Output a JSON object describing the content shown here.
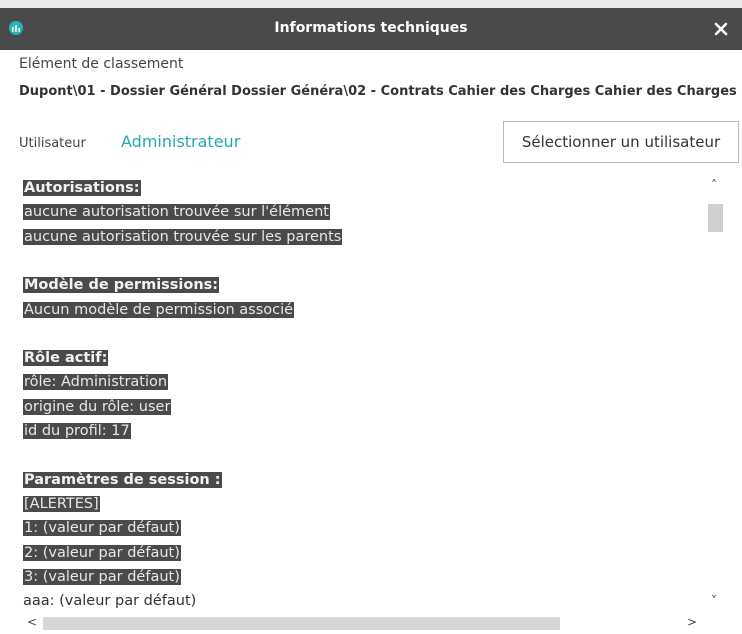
{
  "window": {
    "title": "Informations techniques",
    "close_glyph": "✕"
  },
  "element": {
    "label": "Elément de classement",
    "path": "Dupont\\01 - Dossier Général Dossier Généra\\02 - Contrats Cahier des Charges Cahier des Charges"
  },
  "user": {
    "label": "Utilisateur",
    "name": "Administrateur",
    "select_button": "Sélectionner un utilisateur"
  },
  "details_lines": [
    {
      "text": "Autorisations:",
      "style": "heading"
    },
    {
      "text": "aucune autorisation trouvée sur l'élément",
      "style": "highlight"
    },
    {
      "text": "aucune autorisation trouvée sur les parents",
      "style": "highlight"
    },
    {
      "text": "",
      "style": "blank"
    },
    {
      "text": "Modèle de permissions:",
      "style": "heading"
    },
    {
      "text": "Aucun modèle de permission associé",
      "style": "highlight"
    },
    {
      "text": "",
      "style": "blank"
    },
    {
      "text": "Rôle actif:",
      "style": "heading"
    },
    {
      "text": "rôle: Administration",
      "style": "highlight"
    },
    {
      "text": "origine du rôle: user",
      "style": "highlight"
    },
    {
      "text": "id du profil: 17",
      "style": "highlight"
    },
    {
      "text": "",
      "style": "blank"
    },
    {
      "text": "Paramètres de session :",
      "style": "heading"
    },
    {
      "text": "[ALERTES]",
      "style": "highlight"
    },
    {
      "text": "1: (valeur par défaut)",
      "style": "highlight"
    },
    {
      "text": "2: (valeur par défaut)",
      "style": "highlight"
    },
    {
      "text": "3: (valeur par défaut)",
      "style": "highlight"
    },
    {
      "text": "aaa: (valeur par défaut)",
      "style": "plain"
    }
  ],
  "scrollbars": {
    "up": "˄",
    "down": "˅",
    "left": "<",
    "right": ">"
  },
  "colors": {
    "titlebar": "#4a4a4a",
    "accent": "#26a9ae",
    "highlight_bg": "#4a4a4a"
  }
}
